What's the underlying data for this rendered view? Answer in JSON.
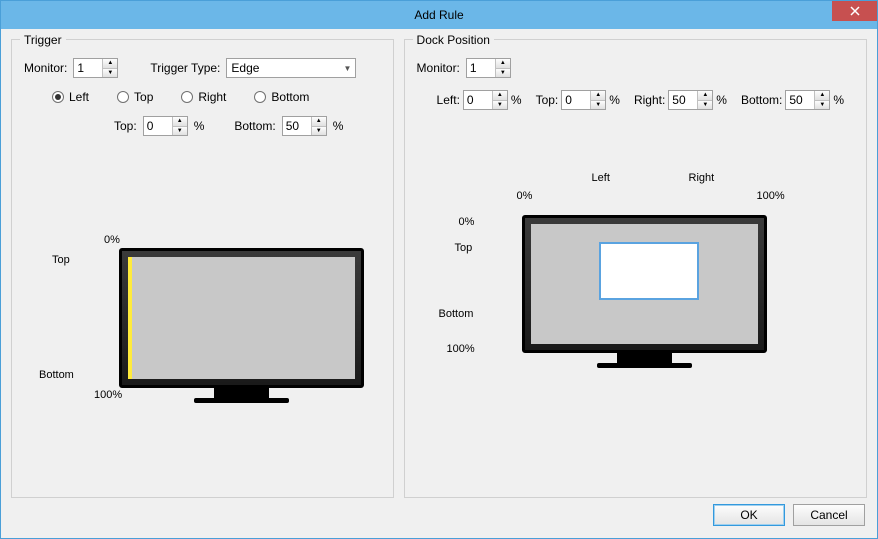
{
  "window": {
    "title": "Add Rule"
  },
  "trigger": {
    "group_label": "Trigger",
    "monitor_label": "Monitor:",
    "monitor_value": "1",
    "type_label": "Trigger Type:",
    "type_value": "Edge",
    "radio_left": "Left",
    "radio_top": "Top",
    "radio_right": "Right",
    "radio_bottom": "Bottom",
    "edge_top_label": "Top:",
    "edge_top_value": "0",
    "edge_bottom_label": "Bottom:",
    "edge_bottom_value": "50",
    "pct": "%",
    "preview_top": "Top",
    "preview_bottom": "Bottom",
    "preview_0": "0%",
    "preview_100": "100%"
  },
  "dock": {
    "group_label": "Dock Position",
    "monitor_label": "Monitor:",
    "monitor_value": "1",
    "left_label": "Left:",
    "left_value": "0",
    "top_label": "Top:",
    "top_value": "0",
    "right_label": "Right:",
    "right_value": "50",
    "bottom_label": "Bottom:",
    "bottom_value": "50",
    "pct": "%",
    "preview_left": "Left",
    "preview_right": "Right",
    "preview_top": "Top",
    "preview_bottom": "Bottom",
    "preview_0": "0%",
    "preview_100": "100%"
  },
  "buttons": {
    "ok": "OK",
    "cancel": "Cancel"
  }
}
